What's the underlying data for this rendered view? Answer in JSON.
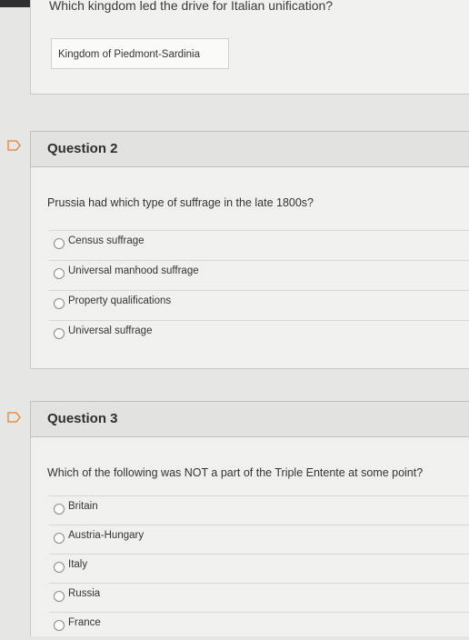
{
  "previous": {
    "question": "Which kingdom led the drive for Italian unification?",
    "answer": "Kingdom of Piedmont-Sardinia"
  },
  "questions": [
    {
      "title": "Question 2",
      "text": "Prussia had which type of suffrage in the late 1800s?",
      "options": [
        "Census suffrage",
        "Universal manhood suffrage",
        "Property qualifications",
        "Universal suffrage"
      ]
    },
    {
      "title": "Question 3",
      "text": "Which of the following was NOT a part of the Triple Entente at some point?",
      "options": [
        "Britain",
        "Austria-Hungary",
        "Italy",
        "Russia",
        "France"
      ]
    }
  ]
}
